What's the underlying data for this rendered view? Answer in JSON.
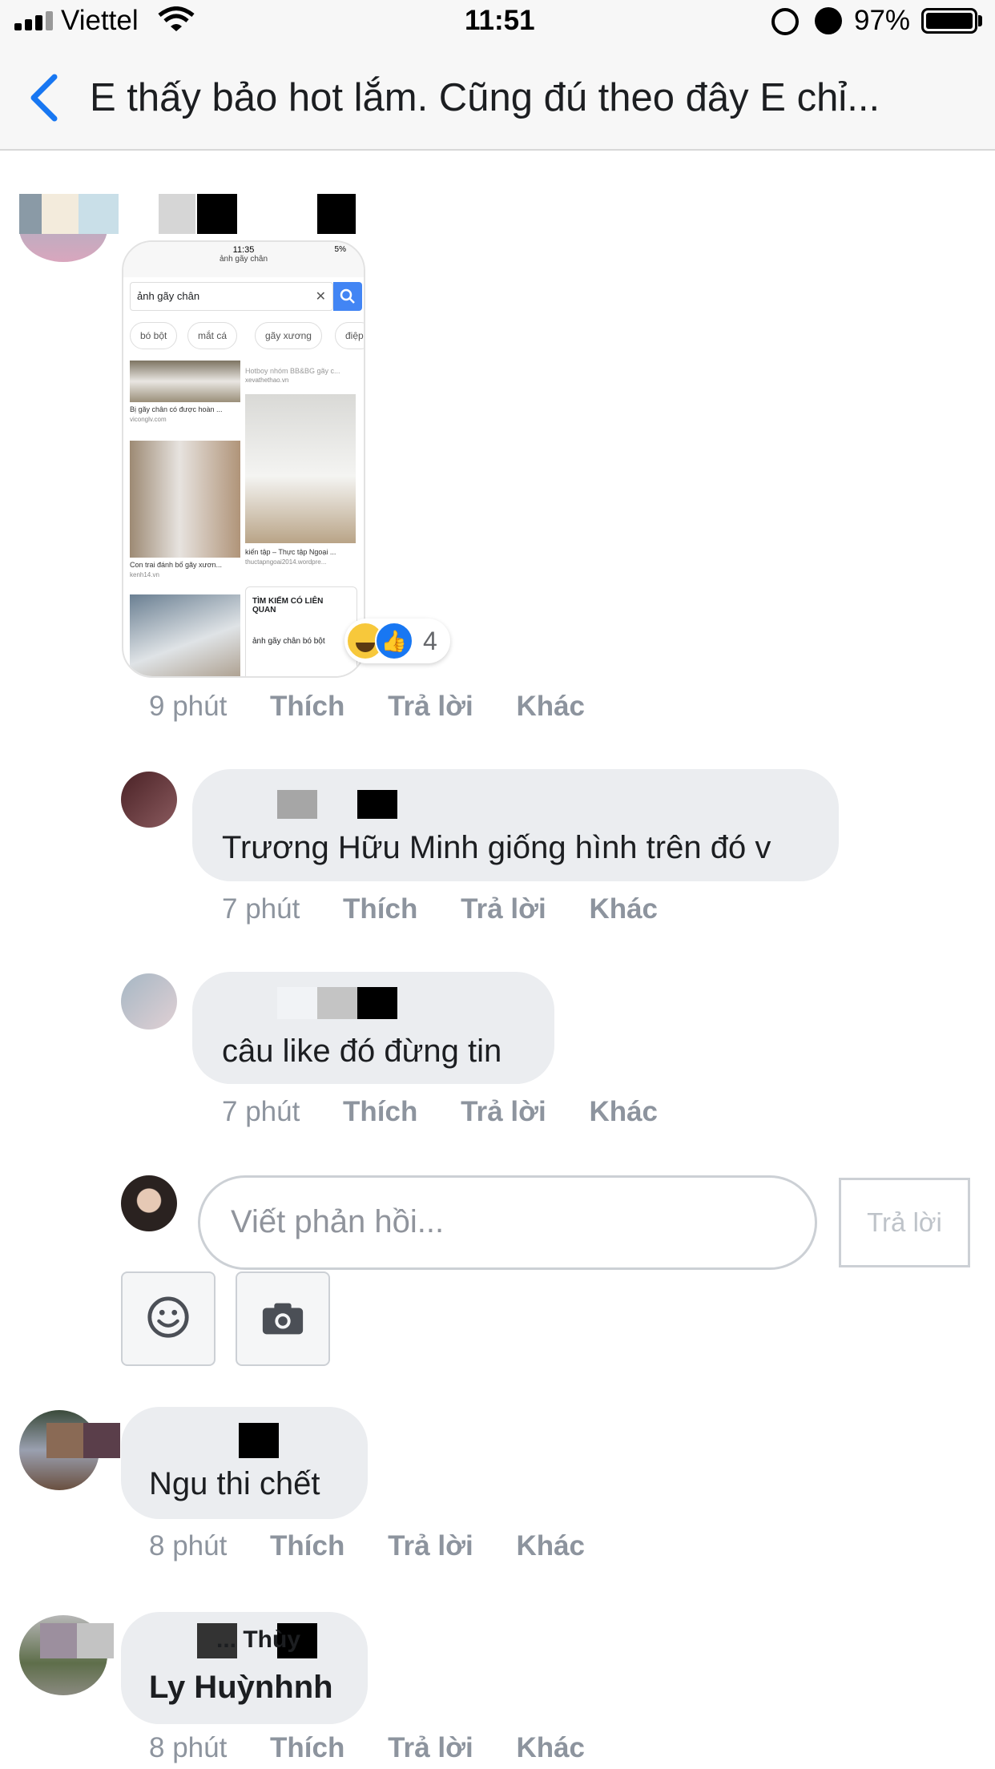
{
  "status_bar": {
    "carrier": "Viettel",
    "time": "11:51",
    "battery": "97%"
  },
  "nav": {
    "title": "E thấy bảo hot lắm. Cũng đú theo đây E chỉ..."
  },
  "comments": [
    {
      "image": {
        "time": "11:35",
        "battery": "5%",
        "url": "ảnh gãy chân",
        "query": "ảnh gãy chân",
        "chips": [
          "bó bột",
          "mắt cá",
          "gãy xương",
          "điệp"
        ],
        "tiles": [
          {
            "caption": "Bị gãy chân có được hoàn ...",
            "source": "viconglv.com"
          },
          {
            "caption": "Con trai đánh bố gãy xươn...",
            "source": "kenh14.vn"
          },
          {
            "caption": "Hotboy nhóm BB&BG gãy c...",
            "source": "xevathethao.vn"
          },
          {
            "caption": "kiến tập – Thực tập Ngoại ...",
            "source": "thuctapngoai2014.wordpre..."
          }
        ],
        "related_title": "TÌM KIẾM CÓ LIÊN QUAN",
        "related_item": "ảnh gãy chân bó bột"
      },
      "reaction_count": "4",
      "time": "9 phút",
      "like": "Thích",
      "reply": "Trả lời",
      "more": "Khác"
    },
    {
      "text": "Trương Hữu Minh giống hình trên đó v",
      "time": "7 phút",
      "like": "Thích",
      "reply": "Trả lời",
      "more": "Khác"
    },
    {
      "text": "câu like đó đừng tin",
      "time": "7 phút",
      "like": "Thích",
      "reply": "Trả lời",
      "more": "Khác"
    },
    {
      "text": "Ngu thi chết",
      "time": "8 phút",
      "like": "Thích",
      "reply": "Trả lời",
      "more": "Khác"
    },
    {
      "text": "Ly Huỳnhnh",
      "name_fragment": "... Thùy",
      "time": "8 phút",
      "like": "Thích",
      "reply": "Trả lời",
      "more": "Khác"
    }
  ],
  "reply_box": {
    "placeholder": "Viết phản hồi...",
    "button": "Trả lời"
  },
  "icons": [
    "back-chevron-icon",
    "wifi-icon",
    "rotation-lock-icon",
    "alarm-icon",
    "battery-icon",
    "emoji-icon",
    "camera-icon",
    "haha-reaction-icon",
    "like-reaction-icon"
  ],
  "colors": {
    "accent": "#1877f2",
    "bubble": "#ebedf0",
    "meta": "#8d949e"
  }
}
